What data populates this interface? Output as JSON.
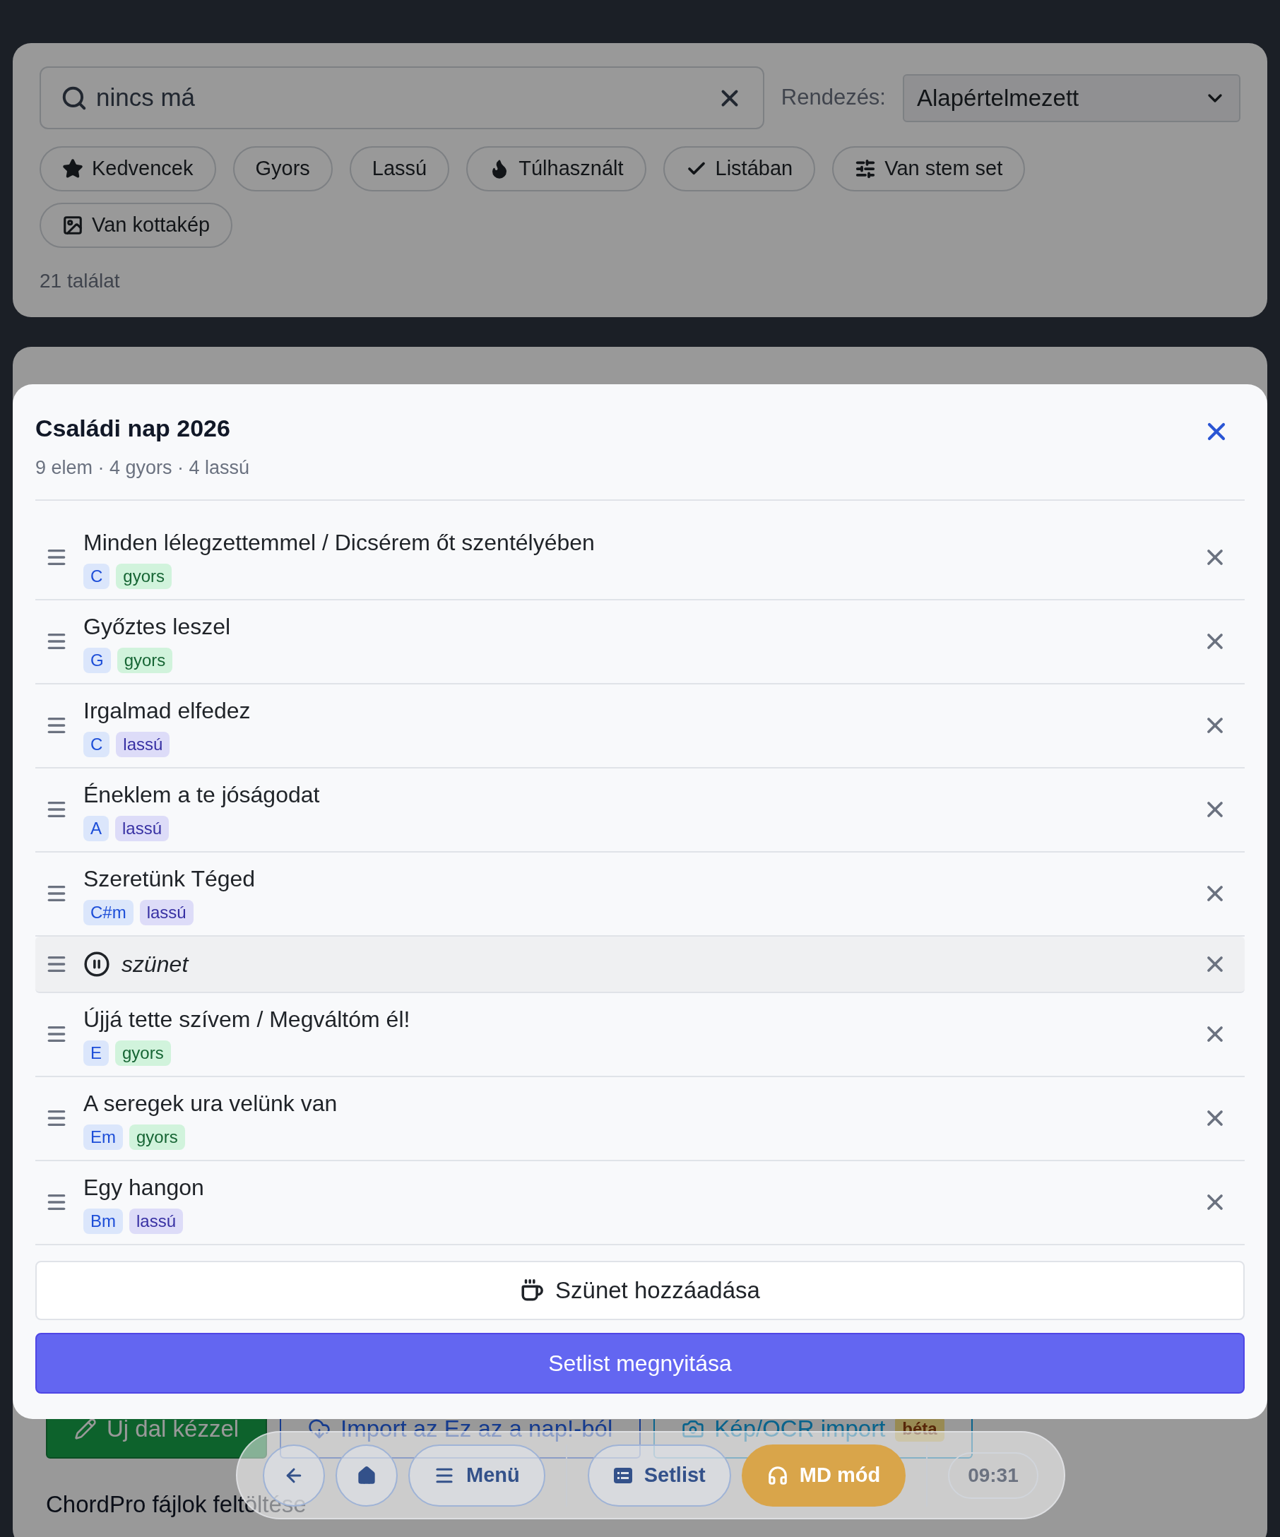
{
  "search": {
    "value": "nincs má"
  },
  "sort": {
    "label": "Rendezés:",
    "value": "Alapértelmezett"
  },
  "filters": [
    {
      "kind": "favorite",
      "label": "Kedvencek"
    },
    {
      "kind": "plain",
      "label": "Gyors"
    },
    {
      "kind": "plain",
      "label": "Lassú"
    },
    {
      "kind": "overused",
      "label": "Túlhasznált"
    },
    {
      "kind": "listed",
      "label": "Listában"
    },
    {
      "kind": "stems",
      "label": "Van stem set"
    },
    {
      "kind": "sheet",
      "label": "Van kottakép"
    }
  ],
  "result_count": "21 találat",
  "actions": [
    {
      "kind": "manual",
      "label": "Új dal kézzel"
    },
    {
      "kind": "import",
      "label": "Import az Ez az a nap!-ból"
    },
    {
      "kind": "ocr",
      "label": "Kép/OCR import",
      "badge": "béta"
    }
  ],
  "upload_title": "ChordPro fájlok feltöltése",
  "modal": {
    "title": "Családi nap 2026",
    "summary": "9 elem · 4 gyors · 4 lassú",
    "items": [
      {
        "kind": "song",
        "title": "Minden lélegzettemmel / Dicsérem őt szentélyében",
        "key": "C",
        "tempo": {
          "kind": "fast",
          "label": "gyors"
        }
      },
      {
        "kind": "song",
        "title": "Győztes leszel",
        "key": "G",
        "tempo": {
          "kind": "fast",
          "label": "gyors"
        }
      },
      {
        "kind": "song",
        "title": "Irgalmad elfedez",
        "key": "C",
        "tempo": {
          "kind": "slow",
          "label": "lassú"
        }
      },
      {
        "kind": "song",
        "title": "Éneklem a te jóságodat",
        "key": "A",
        "tempo": {
          "kind": "slow",
          "label": "lassú"
        }
      },
      {
        "kind": "song",
        "title": "Szeretünk Téged",
        "key": "C#m",
        "tempo": {
          "kind": "slow",
          "label": "lassú"
        }
      },
      {
        "kind": "pause",
        "title": "szünet"
      },
      {
        "kind": "song",
        "title": "Újjá tette szívem / Megváltóm él!",
        "key": "E",
        "tempo": {
          "kind": "fast",
          "label": "gyors"
        }
      },
      {
        "kind": "song",
        "title": "A seregek ura velünk van",
        "key": "Em",
        "tempo": {
          "kind": "fast",
          "label": "gyors"
        }
      },
      {
        "kind": "song",
        "title": "Egy hangon",
        "key": "Bm",
        "tempo": {
          "kind": "slow",
          "label": "lassú"
        }
      }
    ],
    "add_break": "Szünet hozzáadása",
    "open": "Setlist megnyitása"
  },
  "nav": {
    "items": [
      {
        "kind": "back",
        "selected": false
      },
      {
        "kind": "home",
        "selected": false
      },
      {
        "kind": "menu",
        "label": "Menü",
        "selected": false
      },
      {
        "kind": "setlist",
        "label": "Setlist",
        "selected": false
      },
      {
        "kind": "md",
        "label": "MD mód",
        "selected": true
      }
    ],
    "clock": "09:31"
  }
}
